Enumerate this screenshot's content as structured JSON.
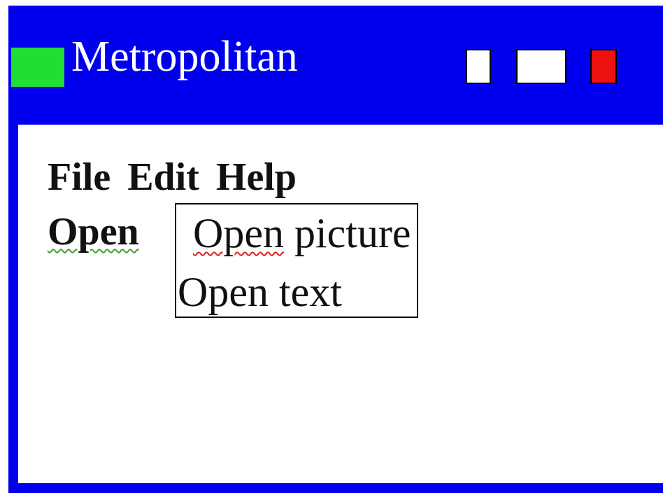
{
  "window": {
    "title": "Metropolitan",
    "colors": {
      "titlebar": "#0000ee",
      "app_icon": "#22dd33",
      "minimize": "#ffffff",
      "maximize": "#ffffff",
      "close": "#ee1111"
    }
  },
  "menubar": {
    "items": [
      {
        "label": "File"
      },
      {
        "label": "Edit"
      },
      {
        "label": "Help"
      }
    ]
  },
  "file_menu": {
    "open_label": "Open",
    "submenu": {
      "items": [
        {
          "label_misspelled_part": "Open",
          "label_rest": " picture"
        },
        {
          "label": "Open text"
        }
      ]
    }
  }
}
